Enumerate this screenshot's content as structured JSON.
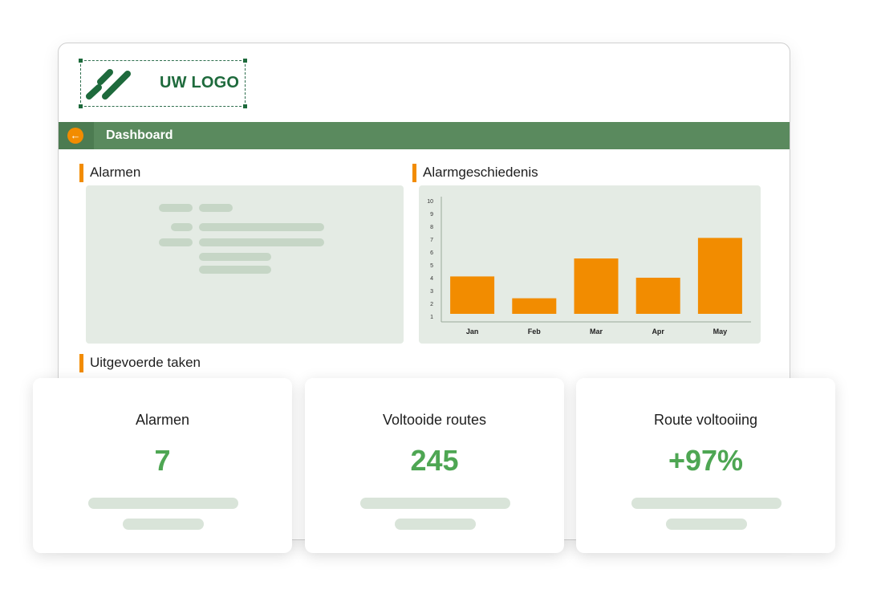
{
  "logo": {
    "text": "UW LOGO"
  },
  "navbar": {
    "title": "Dashboard",
    "back_icon": "arrow-left-icon"
  },
  "sections": {
    "alarms": "Alarmen",
    "alarm_history": "Alarmgeschiedenis",
    "completed_tasks": "Uitgevoerde taken"
  },
  "chart_data": {
    "type": "bar",
    "categories": [
      "Jan",
      "Feb",
      "Mar",
      "Apr",
      "May"
    ],
    "values": [
      3.6,
      1.9,
      5.0,
      3.5,
      6.6
    ],
    "yticks": [
      1,
      2,
      3,
      4,
      5,
      6,
      7,
      8,
      9,
      10
    ],
    "ylim": [
      1,
      10
    ],
    "bar_color": "#f28c00",
    "grid": false
  },
  "stats": [
    {
      "label": "Alarmen",
      "value": "7"
    },
    {
      "label": "Voltooide routes",
      "value": "245"
    },
    {
      "label": "Route voltooiing",
      "value": "+97%"
    }
  ],
  "colors": {
    "brand_green": "#1e6a3c",
    "navbar_green": "#5a8a5e",
    "accent_orange": "#f28c00",
    "stat_green": "#4ea653",
    "panel_bg": "#e4ebe4"
  }
}
